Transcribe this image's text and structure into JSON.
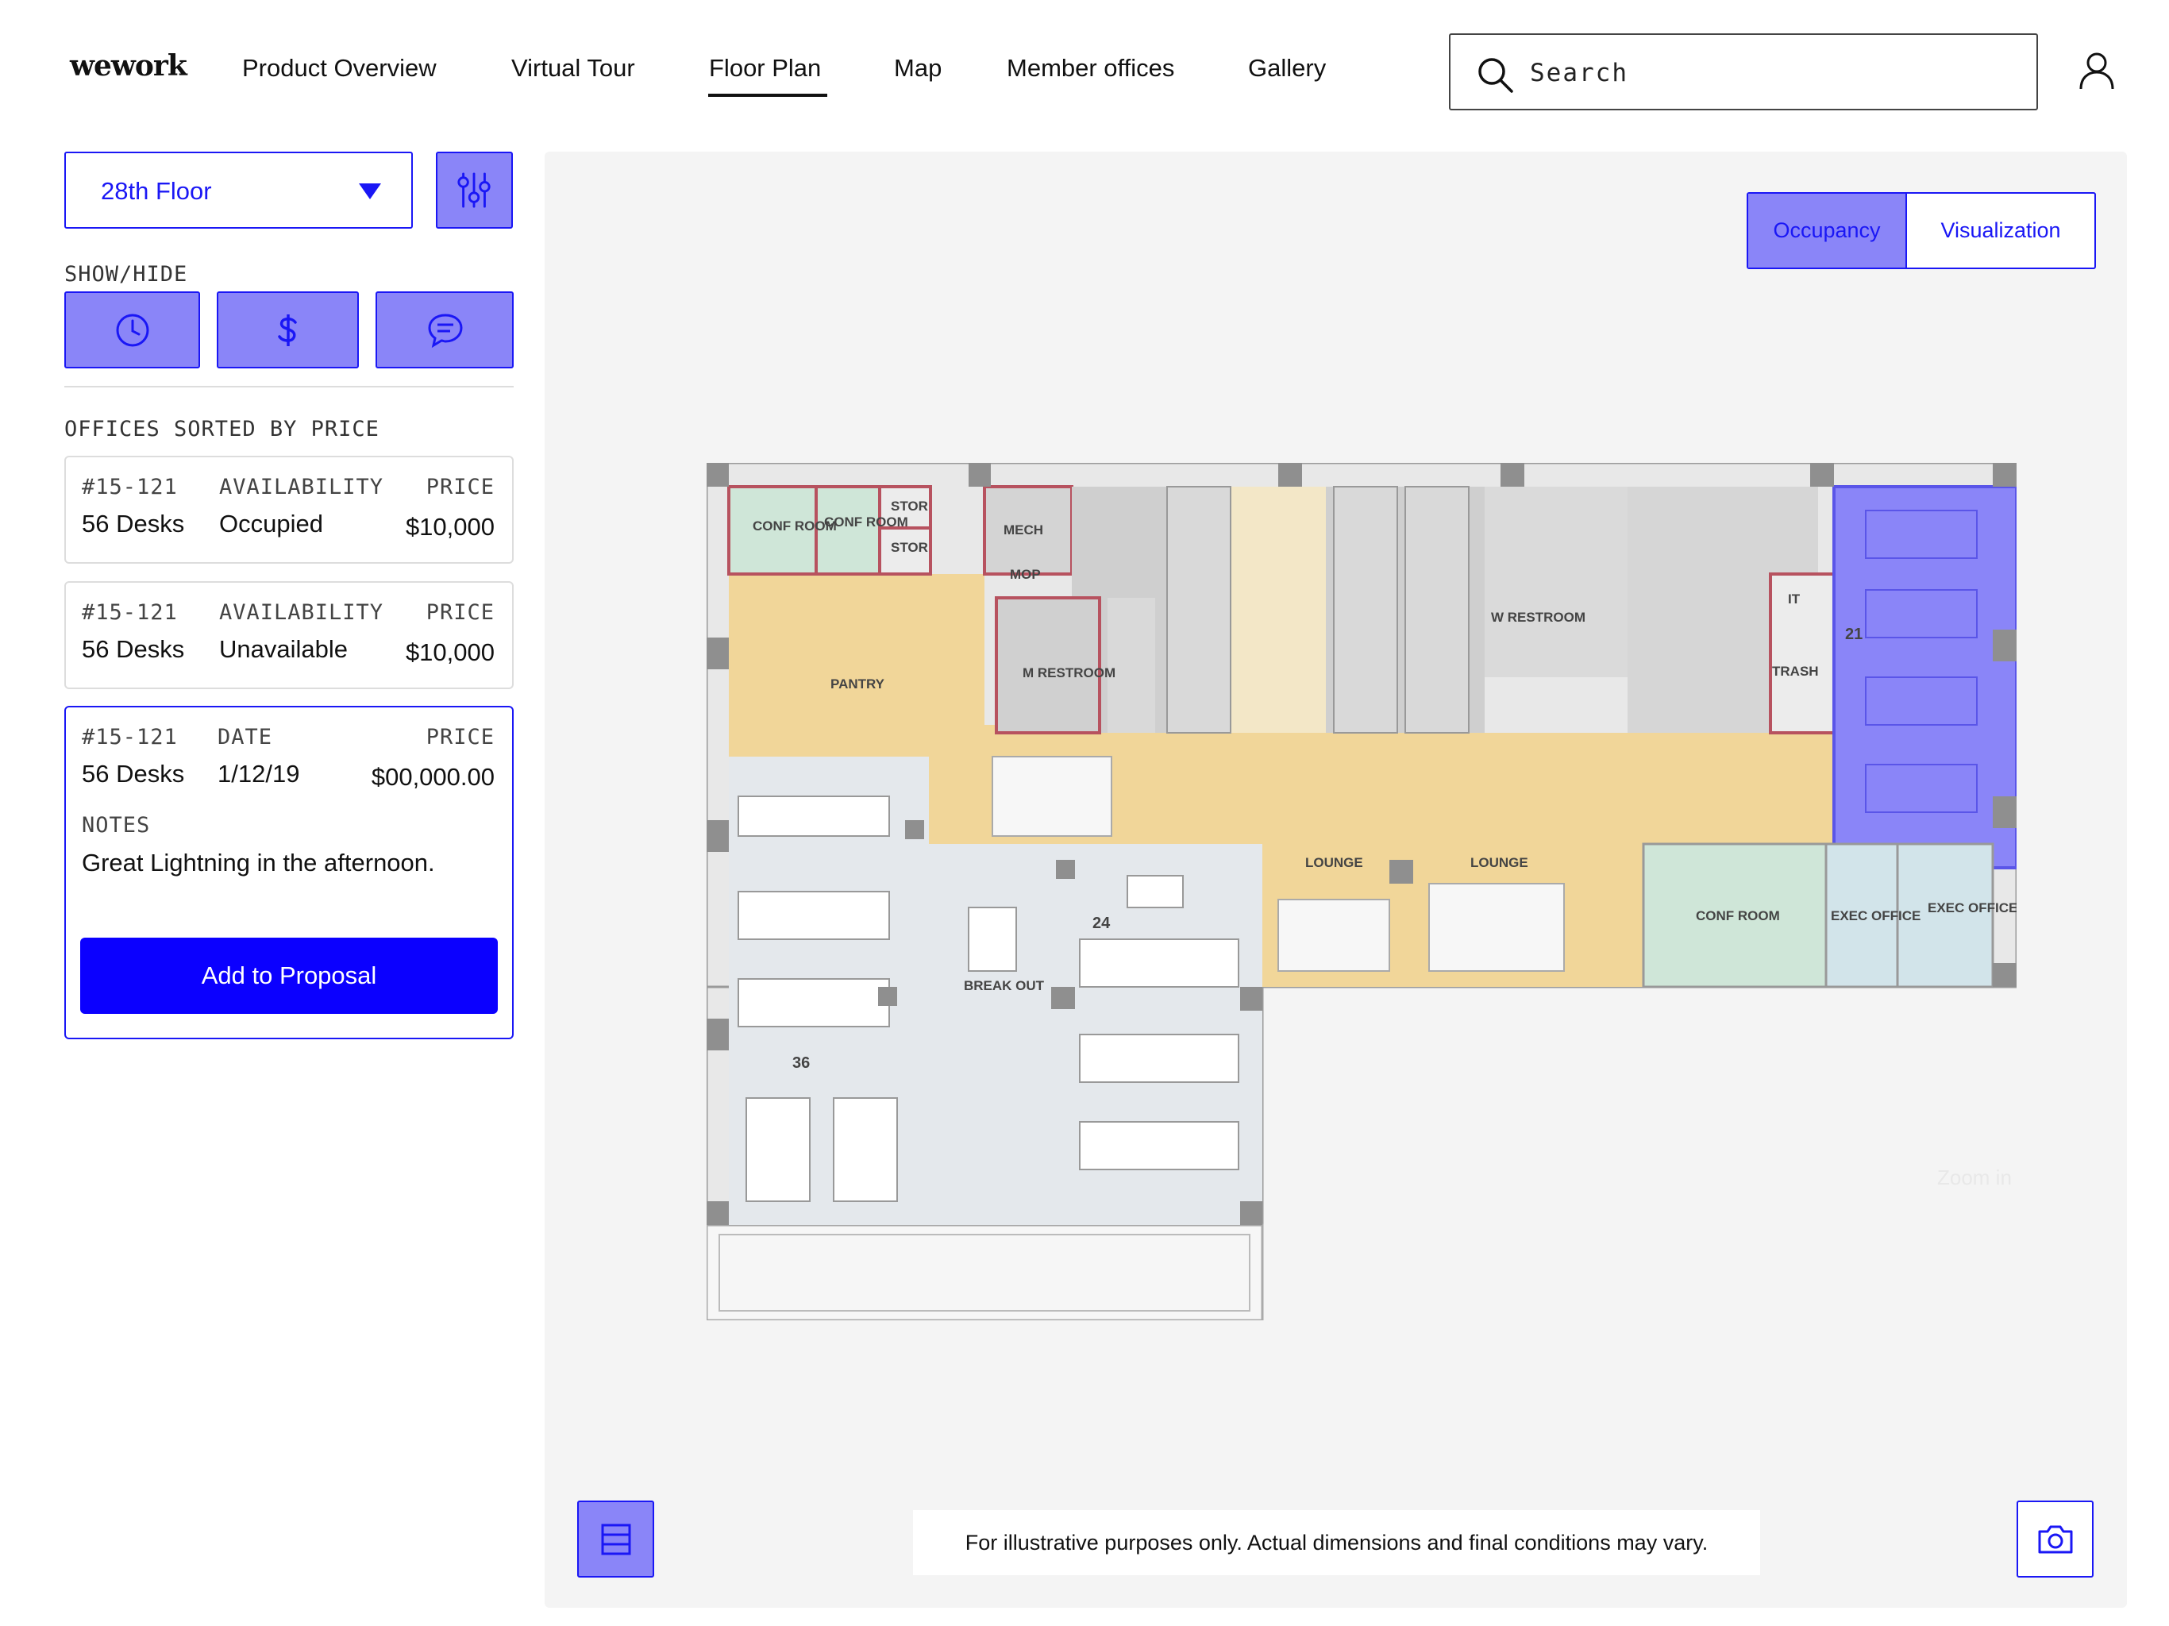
{
  "brand": {
    "logo": "wework"
  },
  "nav": {
    "items": [
      "Product Overview",
      "Virtual Tour",
      "Floor Plan",
      "Map",
      "Member offices",
      "Gallery"
    ],
    "active": "Floor Plan"
  },
  "search": {
    "placeholder": "Search"
  },
  "floor_select": {
    "value": "28th Floor"
  },
  "show_hide": {
    "label": "SHOW/HIDE",
    "toggles": [
      "clock-icon",
      "dollar-icon",
      "chat-icon"
    ]
  },
  "offices": {
    "heading": "OFFICES SORTED BY PRICE",
    "cards": [
      {
        "id": "#15-121",
        "col2_label": "AVAILABILITY",
        "price_label": "PRICE",
        "desks": "56 Desks",
        "col2_value": "Occupied",
        "price": "$10,000"
      },
      {
        "id": "#15-121",
        "col2_label": "AVAILABILITY",
        "price_label": "PRICE",
        "desks": "56 Desks",
        "col2_value": "Unavailable",
        "price": "$10,000"
      },
      {
        "id": "#15-121",
        "col2_label": "DATE",
        "price_label": "PRICE",
        "desks": "56 Desks",
        "col2_value": "1/12/19",
        "price": "$00,000.00",
        "notes_label": "NOTES",
        "notes": "Great Lightning in the afternoon.",
        "action": "Add to Proposal"
      }
    ]
  },
  "view_toggle": {
    "options": [
      "Occupancy",
      "Visualization"
    ],
    "selected": "Occupancy"
  },
  "floorplan": {
    "rooms": [
      "CONF ROOM",
      "CONF ROOM",
      "STOR",
      "STOR",
      "MECH",
      "MOP",
      "M RESTROOM",
      "W RESTROOM",
      "IT",
      "TRASH",
      "PANTRY",
      "LOUNGE",
      "LOUNGE",
      "CONF ROOM",
      "EXEC OFFICE",
      "EXEC OFFICE",
      "BREAK OUT"
    ],
    "desk_counts": [
      "21",
      "24",
      "36"
    ],
    "zoom_label": "Zoom in",
    "colors": {
      "highlight": "#8a85f8",
      "common": "#f1d699",
      "open_desk": "#e4e8ec",
      "meeting": "#cfe6d8",
      "core": "#d4d4d4"
    }
  },
  "disclaimer": "For illustrative purposes only. Actual dimensions and final conditions may vary.",
  "colors": {
    "accent": "#1a17f5",
    "accent_fill": "#8a85f8",
    "primary_button": "#0b00ff"
  }
}
